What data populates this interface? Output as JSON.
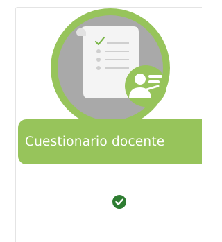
{
  "card": {
    "title": "Cuestionario docente",
    "status_icon": "check-circle-icon",
    "illustration_icon": "questionnaire-document-icon"
  },
  "colors": {
    "accent_green": "#97c45b",
    "circle_gray": "#a9a9a9",
    "check_green": "#2e7d32"
  }
}
